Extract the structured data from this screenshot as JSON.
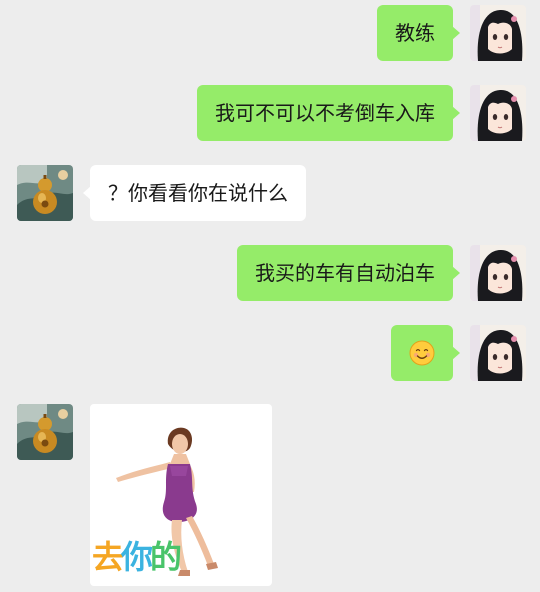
{
  "messages": [
    {
      "side": "right",
      "type": "text",
      "text": "教练"
    },
    {
      "side": "right",
      "type": "text",
      "text": "我可不可以不考倒车入库"
    },
    {
      "side": "left",
      "type": "text",
      "text": "？你看看你在说什么"
    },
    {
      "side": "right",
      "type": "text",
      "text": "我买的车有自动泊车"
    },
    {
      "side": "right",
      "type": "emoji",
      "emoji": "smile-emoji"
    },
    {
      "side": "left",
      "type": "sticker",
      "caption": [
        "去",
        "你",
        "的"
      ]
    }
  ],
  "avatars": {
    "me": "anime-girl-avatar",
    "other": "golden-gourd-avatar"
  },
  "colors": {
    "background": "#ededed",
    "my_bubble": "#95ec69",
    "other_bubble": "#ffffff",
    "text": "#191919"
  }
}
